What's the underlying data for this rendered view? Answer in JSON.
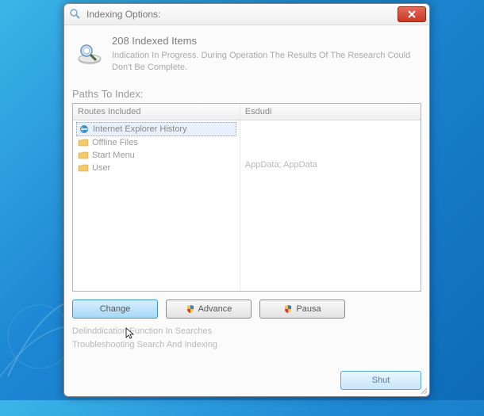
{
  "window": {
    "title": "Indexing Options:"
  },
  "header": {
    "count_line": "208 Indexed Items",
    "status": "Indication In Progress. During Operation The Results Of The Research Could Don't Be Complete."
  },
  "section": {
    "label": "Paths To Index:"
  },
  "columns": {
    "left": "Routes Included",
    "right": "Esdudi"
  },
  "items": [
    {
      "label": "Internet Explorer History",
      "icon": "ie"
    },
    {
      "label": "Offline Files",
      "icon": "folder"
    },
    {
      "label": "Start Menu",
      "icon": "folder"
    },
    {
      "label": "User",
      "icon": "folder"
    }
  ],
  "exclude": {
    "text": "AppData; AppData"
  },
  "buttons": {
    "change": "Change",
    "advanced": "Advance",
    "pause": "Pausa",
    "close": "Shut"
  },
  "links": {
    "line1": "Delinddication Function In Searches",
    "line2": "Troubleshooting Search And Indexing"
  }
}
